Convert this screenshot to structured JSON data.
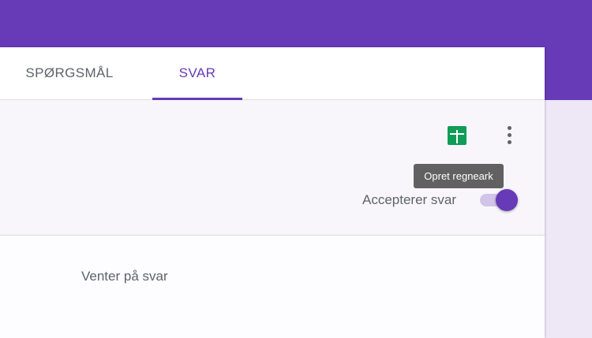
{
  "tabs": {
    "questions_label": "SPØRGSMÅL",
    "responses_label": "SVAR"
  },
  "summary": {
    "sheets_icon": "create-spreadsheet-icon",
    "more_icon": "more-vert-icon",
    "tooltip": "Opret regneark",
    "accepting_label": "Accepterer svar",
    "accepting_responses": true
  },
  "responses": {
    "empty_text": "Venter på svar"
  },
  "colors": {
    "accent": "#673ab7",
    "sheets_green": "#0f9d58",
    "background": "#ede7f6"
  }
}
